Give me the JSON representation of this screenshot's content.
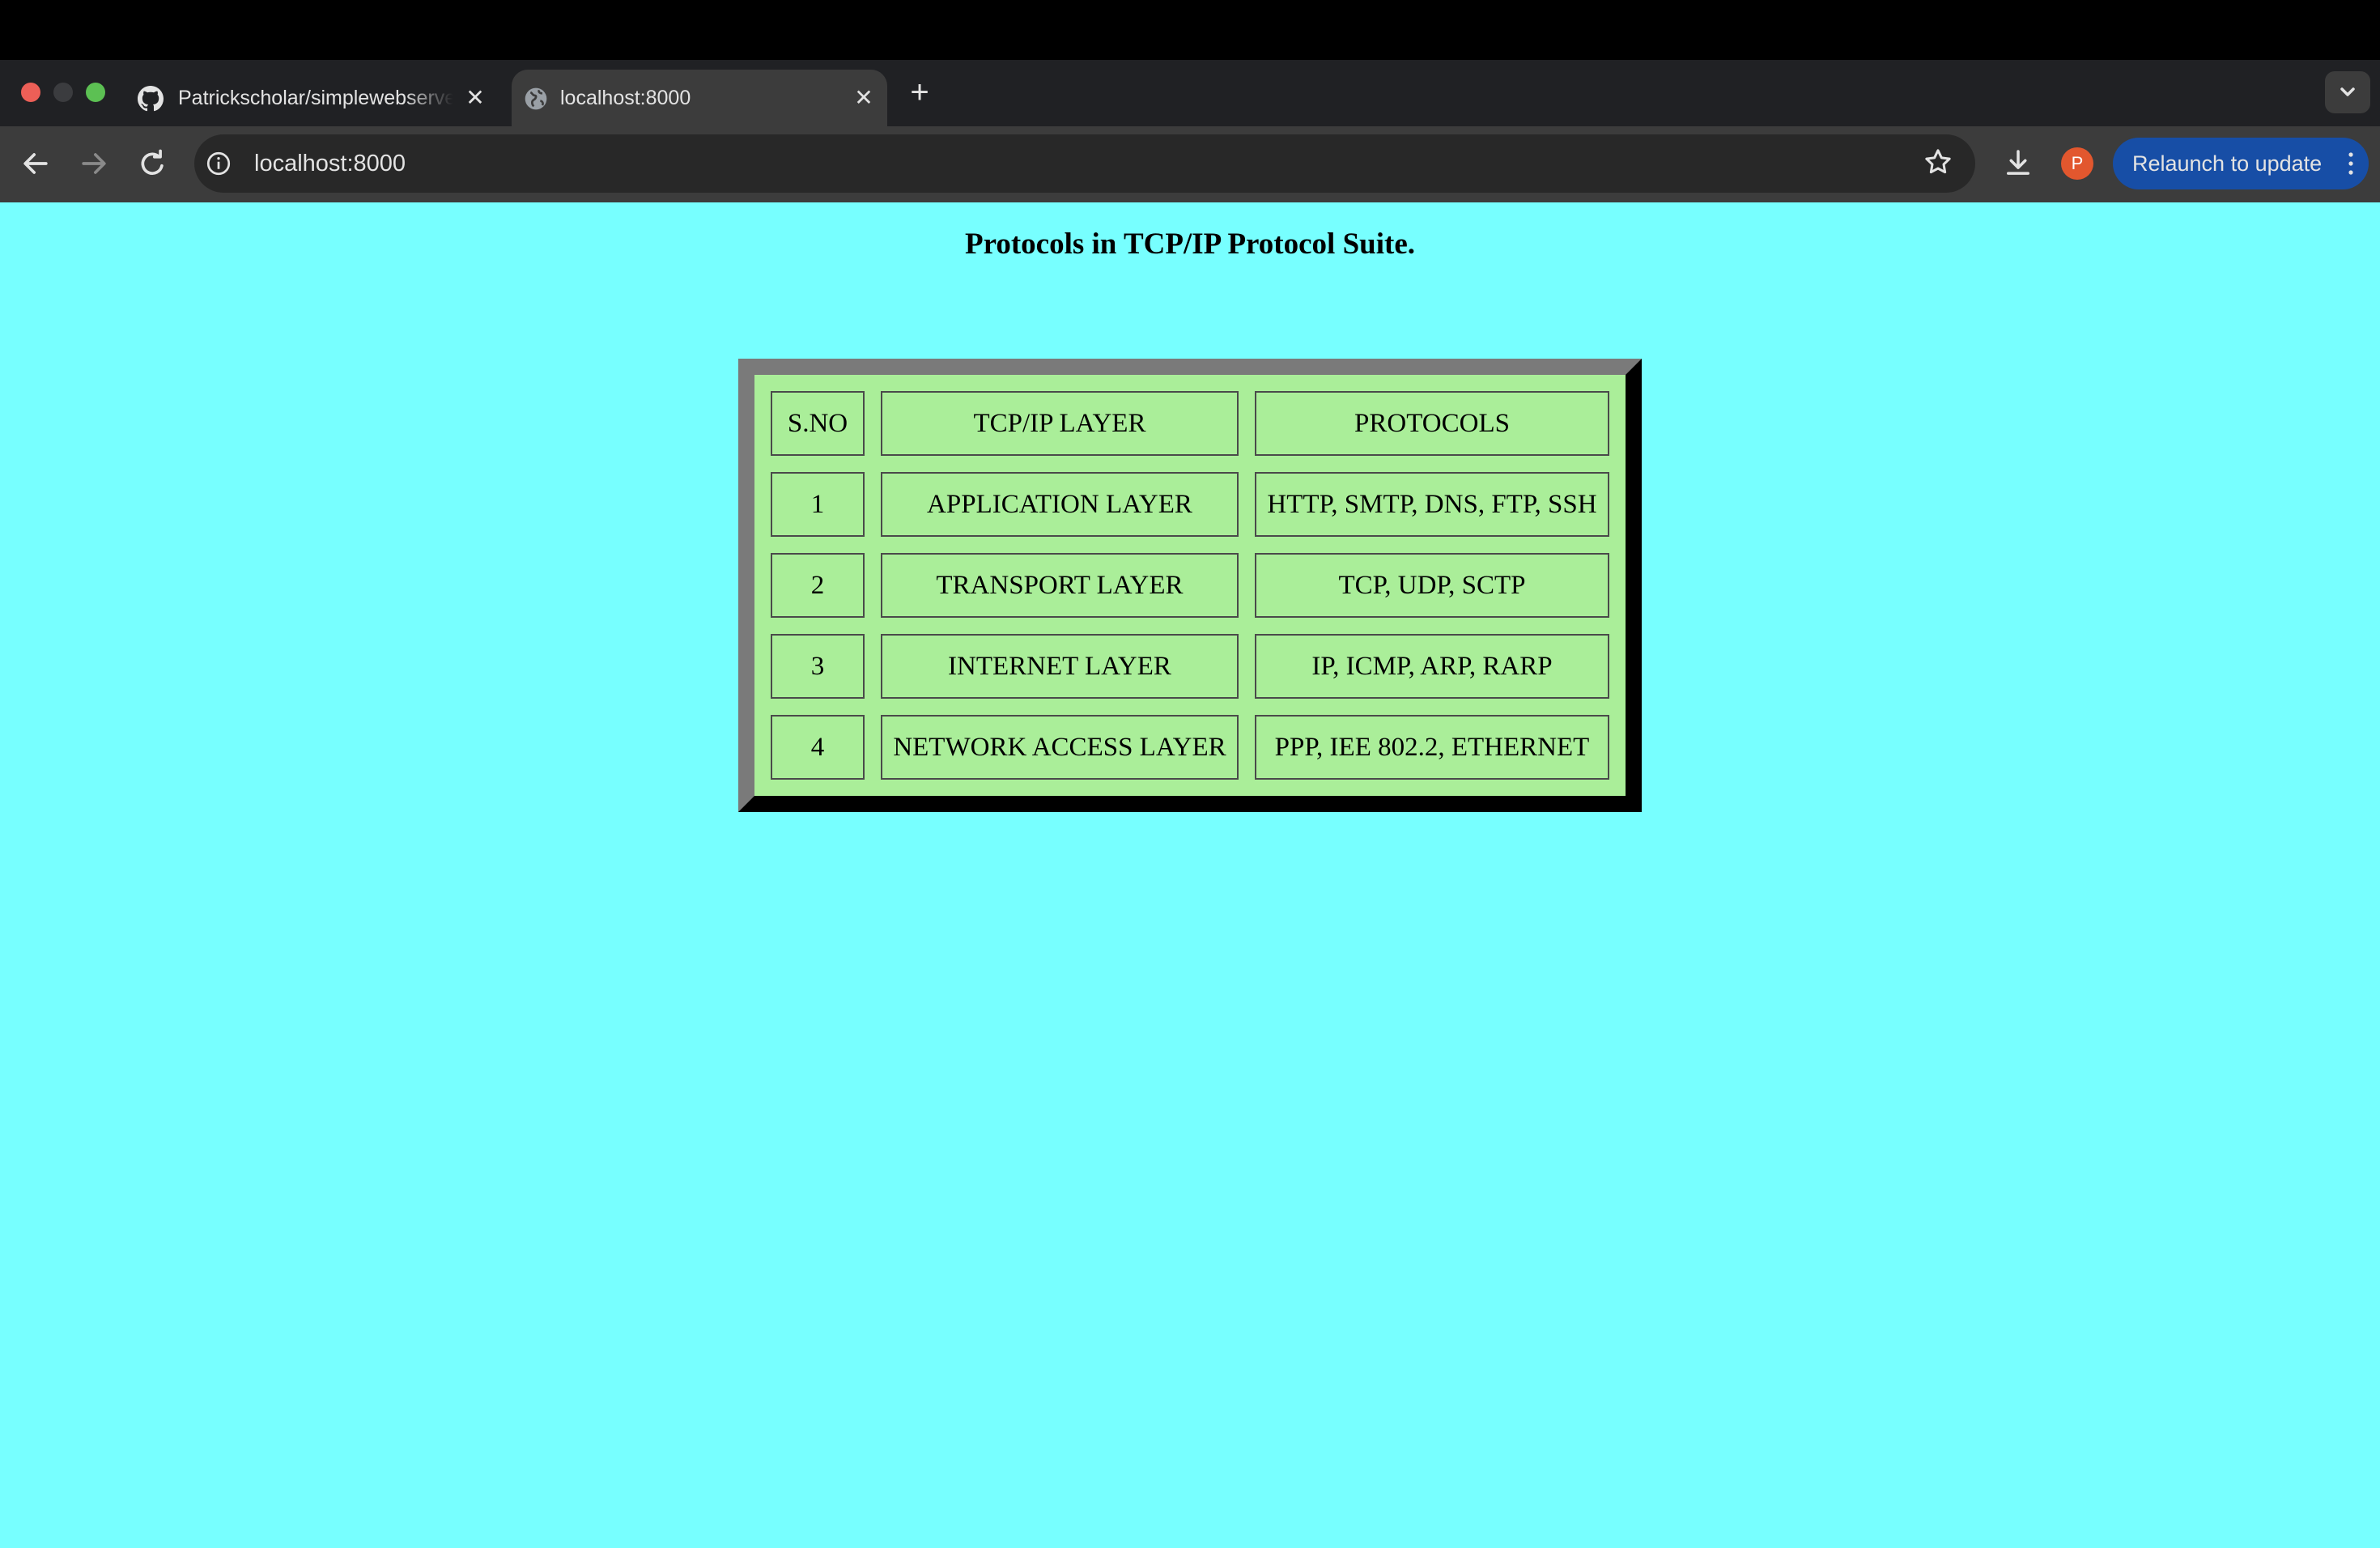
{
  "browser": {
    "tabs": [
      {
        "title": "Patrickscholar/simplewebserver",
        "icon": "github-icon",
        "active": false
      },
      {
        "title": "localhost:8000",
        "icon": "globe-icon",
        "active": true
      }
    ],
    "close_glyph": "✕",
    "new_tab_glyph": "+",
    "url": "localhost:8000",
    "profile_initial": "P",
    "relaunch_label": "Relaunch to update",
    "colors": {
      "tabstrip": "#202124",
      "toolbar": "#3c3c3c",
      "omnibox": "#282828",
      "relaunch": "#174ea6",
      "avatar": "#e2572e"
    }
  },
  "page": {
    "heading": "Protocols in TCP/IP Protocol Suite.",
    "background": "#77ffff",
    "table": {
      "background": "#aaee99",
      "headers": [
        "S.NO",
        "TCP/IP LAYER",
        "PROTOCOLS"
      ],
      "rows": [
        [
          "1",
          "APPLICATION LAYER",
          "HTTP, SMTP, DNS, FTP, SSH"
        ],
        [
          "2",
          "TRANSPORT LAYER",
          "TCP, UDP, SCTP"
        ],
        [
          "3",
          "INTERNET LAYER",
          "IP, ICMP, ARP, RARP"
        ],
        [
          "4",
          "NETWORK ACCESS LAYER",
          "PPP, IEE 802.2, ETHERNET"
        ]
      ]
    }
  }
}
